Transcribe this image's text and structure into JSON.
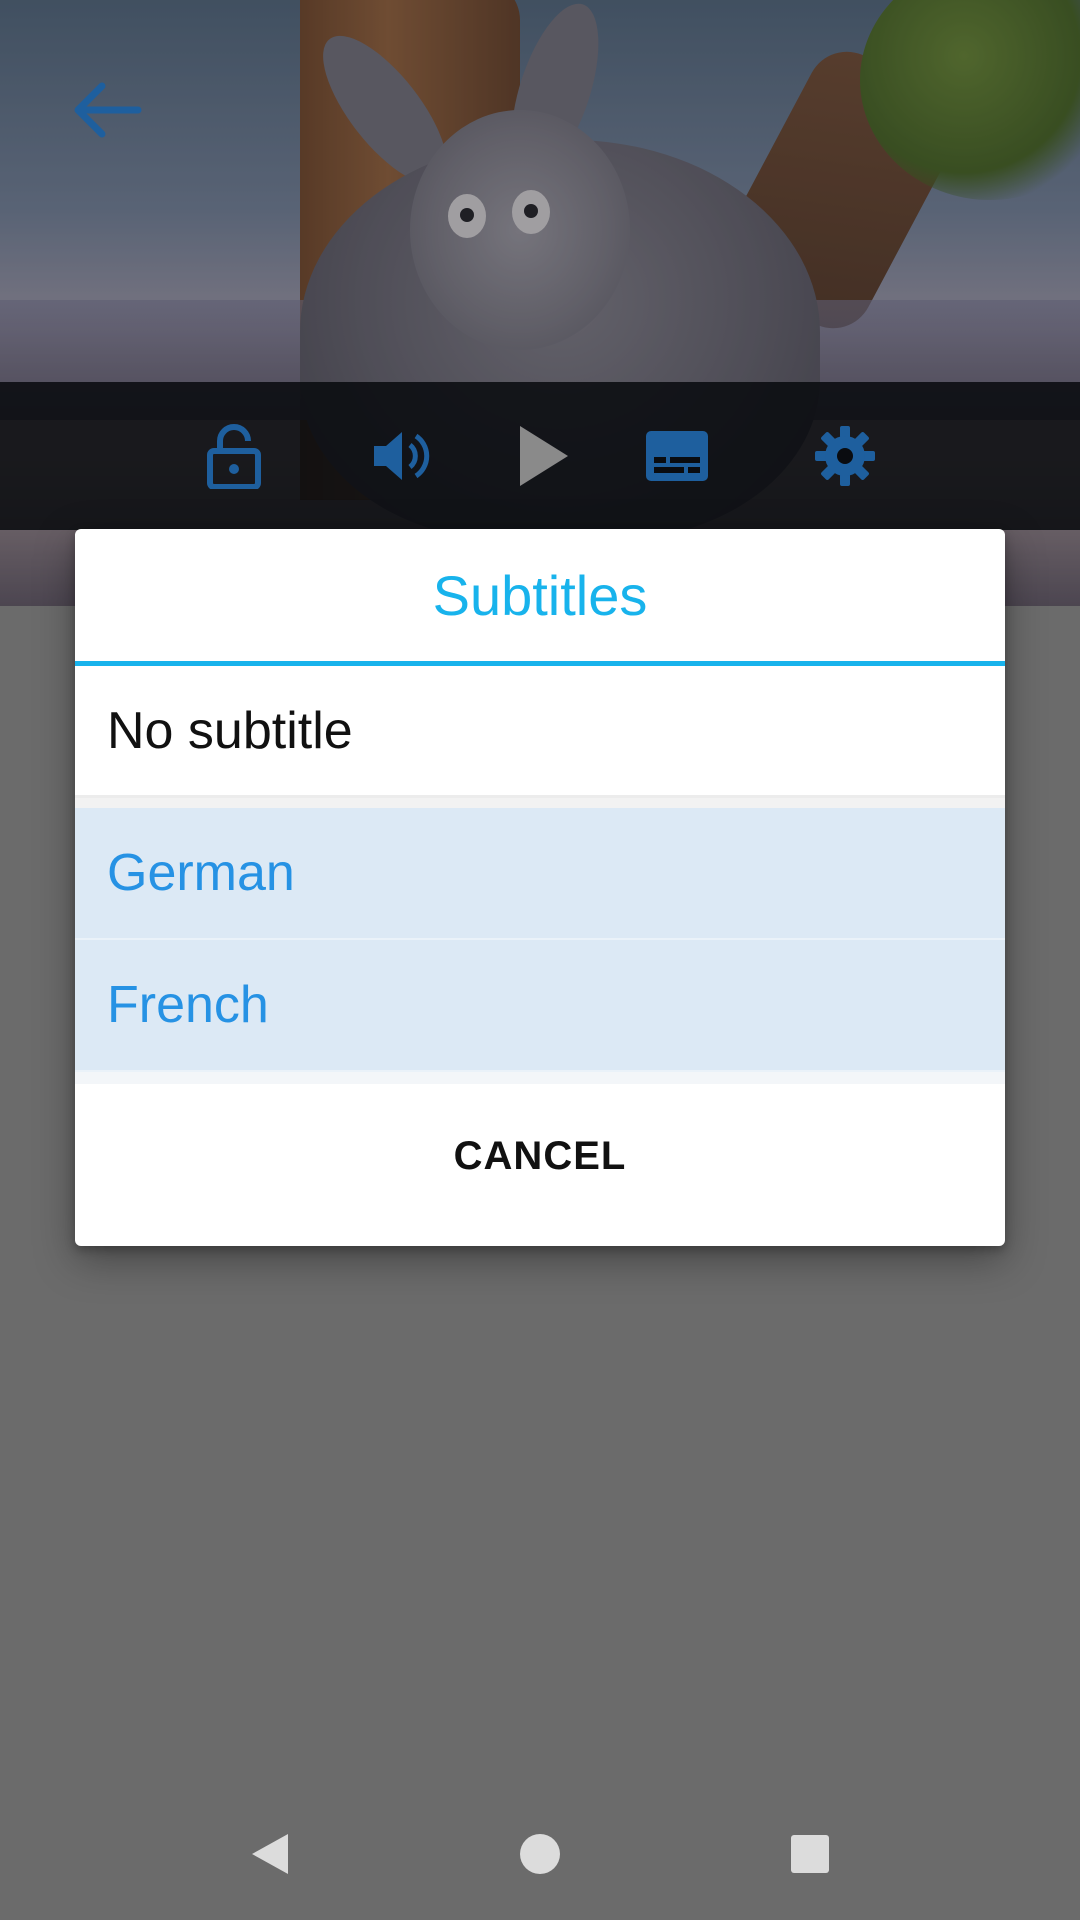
{
  "player": {
    "controls": [
      {
        "id": "lock",
        "icon": "lock-icon"
      },
      {
        "id": "volume",
        "icon": "volume-icon"
      },
      {
        "id": "play",
        "icon": "play-icon"
      },
      {
        "id": "subtitles",
        "icon": "subtitles-icon"
      },
      {
        "id": "settings",
        "icon": "gear-icon"
      }
    ],
    "back_icon": "arrow-back-icon"
  },
  "dialog": {
    "title": "Subtitles",
    "options": [
      {
        "label": "No subtitle",
        "state": "normal"
      },
      {
        "label": "German",
        "state": "highlighted"
      },
      {
        "label": "French",
        "state": "highlighted"
      }
    ],
    "cancel_label": "CANCEL"
  },
  "colors": {
    "accent": "#18b3ec",
    "selected_text": "#2692e4",
    "selected_bg": "#dce9f5",
    "icon_blue": "#1e5f9e",
    "scrim": "#6b6b6b"
  },
  "system_nav": [
    "back-icon",
    "home-icon",
    "recents-icon"
  ]
}
